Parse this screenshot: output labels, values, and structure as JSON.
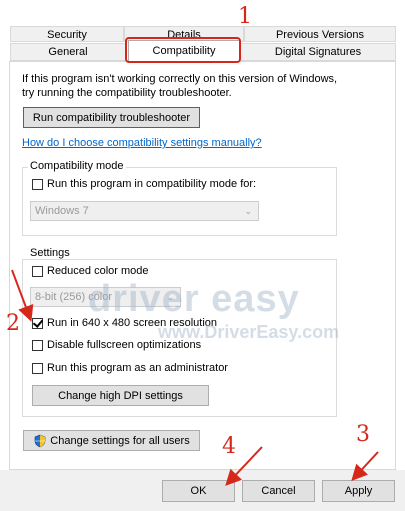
{
  "tabs": {
    "row1": [
      "Security",
      "Details",
      "Previous Versions"
    ],
    "row2": [
      "General",
      "Compatibility",
      "Digital Signatures"
    ],
    "active": "Compatibility"
  },
  "intro_text": [
    "If this program isn't working correctly on this version of Windows,",
    "try running the compatibility troubleshooter."
  ],
  "troubleshooter_button": "Run compatibility troubleshooter",
  "manual_link": "How do I choose compatibility settings manually?",
  "compat_mode": {
    "title": "Compatibility mode",
    "checkbox_label": "Run this program in compatibility mode for:",
    "checked": false,
    "select_value": "Windows 7"
  },
  "settings": {
    "title": "Settings",
    "reduced_color_label": "Reduced color mode",
    "reduced_color_checked": false,
    "color_select_value": "8-bit (256) color",
    "run_640_label": "Run in 640 x 480 screen resolution",
    "run_640_checked": true,
    "disable_fullscreen_label": "Disable fullscreen optimizations",
    "disable_fullscreen_checked": false,
    "run_admin_label": "Run this program as an administrator",
    "run_admin_checked": false,
    "dpi_button": "Change high DPI settings"
  },
  "all_users_button": "Change settings for all users",
  "dialog_buttons": {
    "ok": "OK",
    "cancel": "Cancel",
    "apply": "Apply"
  },
  "watermark": {
    "logo": "driver easy",
    "url": "www.DriverEasy.com"
  },
  "annotations": [
    "1",
    "2",
    "3",
    "4"
  ],
  "colors": {
    "annotation_red": "#d6271b",
    "link_blue": "#0066cc",
    "focus_blue": "#0078d7"
  }
}
